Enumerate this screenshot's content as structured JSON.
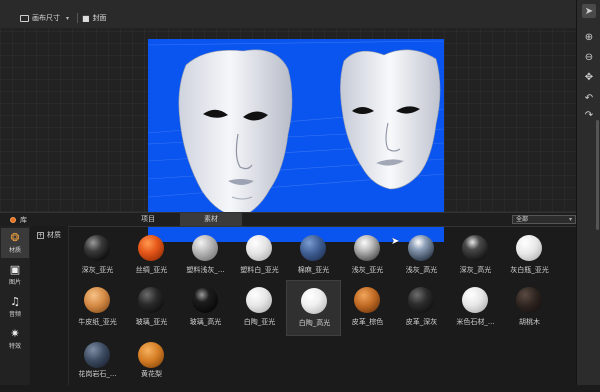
{
  "toolbar": {
    "canvas_size_label": "画布尺寸",
    "cover_label": "封面",
    "icons": [
      "canvas-size-icon",
      "chevron-down-icon",
      "camera-icon"
    ]
  },
  "viewport": {
    "background_color": "#0a55f0",
    "content": "two-white-masks"
  },
  "right_rail": {
    "tools": [
      "pointer-icon",
      "zoom-in-icon",
      "zoom-out-icon",
      "move-icon",
      "undo-icon",
      "redo-icon"
    ]
  },
  "library": {
    "title": "库",
    "tabs": [
      "项目",
      "素材"
    ],
    "active_tab": "素材",
    "filter_value": "全部",
    "categories": [
      {
        "label": "材质",
        "icon": "material-icon",
        "active": true
      },
      {
        "label": "图片",
        "icon": "image-icon",
        "active": false
      },
      {
        "label": "音频",
        "icon": "music-icon",
        "active": false
      },
      {
        "label": "特效",
        "icon": "effects-icon",
        "active": false
      }
    ],
    "sub_item": "材质",
    "materials": [
      {
        "label": "深灰_亚光"
      },
      {
        "label": "丝绸_亚光"
      },
      {
        "label": "塑料浅灰_..."
      },
      {
        "label": "塑料白_亚光"
      },
      {
        "label": "棉麻_亚光"
      },
      {
        "label": "浅灰_亚光"
      },
      {
        "label": "浅灰_高光"
      },
      {
        "label": "深灰_高光"
      },
      {
        "label": "灰白瓶_亚光"
      },
      {
        "label": "牛皮纸_亚光"
      },
      {
        "label": "玻璃_亚光"
      },
      {
        "label": "玻璃_高光"
      },
      {
        "label": "白陶_亚光"
      },
      {
        "label": "白陶_高光"
      },
      {
        "label": "皮革_棕色"
      },
      {
        "label": "皮革_深灰"
      },
      {
        "label": "米色石材_..."
      },
      {
        "label": "胡桃木"
      },
      {
        "label": "花岗岩石_..."
      },
      {
        "label": "黄花梨"
      }
    ],
    "selected_material": "白陶_高光"
  }
}
